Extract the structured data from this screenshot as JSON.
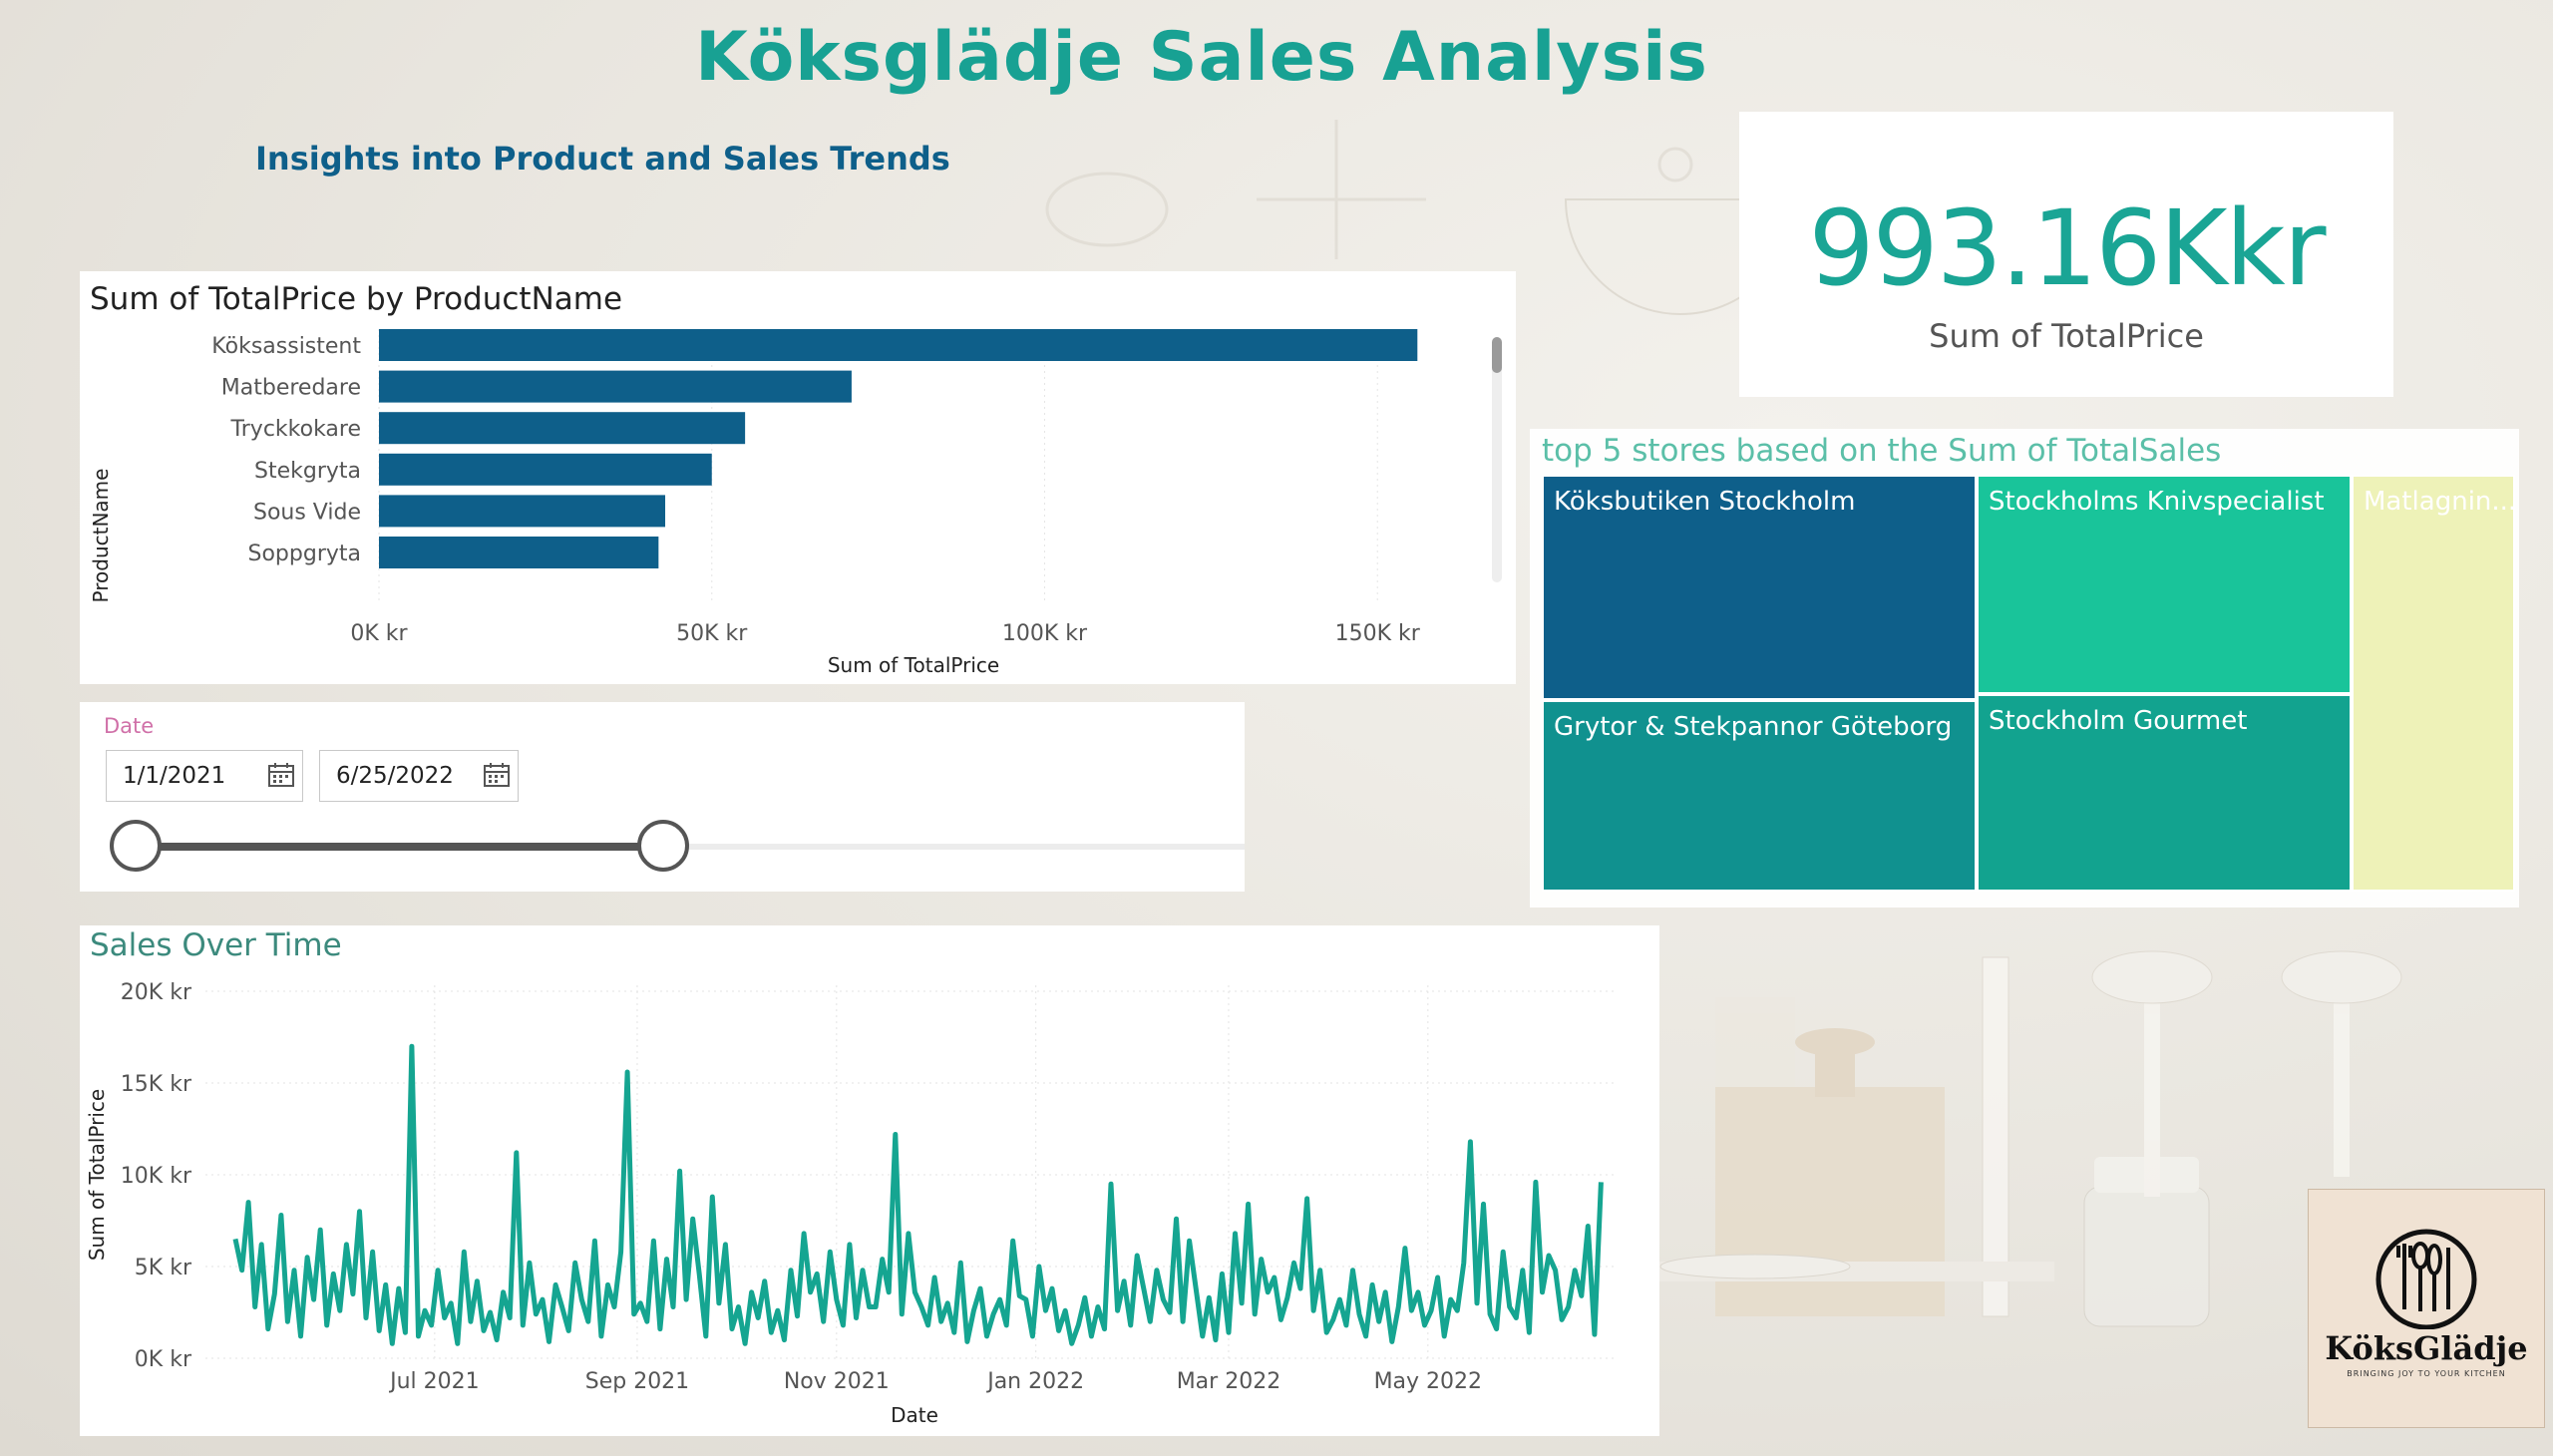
{
  "page": {
    "title": "Köksglädje Sales Analysis",
    "subtitle": "Insights into Product and Sales Trends"
  },
  "colors": {
    "title": "#18a193",
    "subtitle": "#0e5f8a",
    "bar": "#0e5f8a",
    "line": "#15a591",
    "kpi": "#1aa595"
  },
  "bar_chart": {
    "title": "Sum of TotalPrice by ProductName",
    "y_axis_title": "ProductName",
    "x_axis_title": "Sum of TotalPrice",
    "tick_labels": [
      "0K kr",
      "50K kr",
      "100K kr",
      "150K kr"
    ]
  },
  "kpi": {
    "value": "993.16Kkr",
    "label": "Sum of TotalPrice"
  },
  "treemap": {
    "title": "top 5 stores based on the Sum of TotalSales",
    "cells": [
      {
        "label": "Köksbutiken Stockholm",
        "color": "#0e5f8a"
      },
      {
        "label": "Grytor & Stekpannor Göteborg",
        "color": "#10918f"
      },
      {
        "label": "Stockholms Knivspecialist",
        "color": "#19c49a"
      },
      {
        "label": "Stockholm Gourmet",
        "color": "#12a38f"
      },
      {
        "label": "Matlagnin...",
        "color": "#eef2b8"
      }
    ]
  },
  "date_slicer": {
    "label": "Date",
    "start": "1/1/2021",
    "end": "6/25/2022",
    "start_icon": "calendar-icon",
    "end_icon": "calendar-icon"
  },
  "line_chart": {
    "title": "Sales Over Time",
    "y_axis_title": "Sum of TotalPrice",
    "x_axis_title": "Date",
    "y_tick_labels": [
      "20K kr",
      "15K kr",
      "10K kr",
      "5K kr",
      "0K kr"
    ],
    "x_tick_labels": [
      "Jul 2021",
      "Sep 2021",
      "Nov 2021",
      "Jan 2022",
      "Mar 2022",
      "May 2022"
    ]
  },
  "logo": {
    "name": "KöksGlädje",
    "tagline": "BRINGING JOY TO YOUR KITCHEN"
  },
  "chart_data": [
    {
      "type": "bar",
      "orientation": "horizontal",
      "title": "Sum of TotalPrice by ProductName",
      "xlabel": "Sum of TotalPrice",
      "ylabel": "ProductName",
      "categories": [
        "Köksassistent",
        "Matberedare",
        "Tryckkokare",
        "Stekgryta",
        "Sous Vide",
        "Soppgryta"
      ],
      "values": [
        156000,
        71000,
        55000,
        50000,
        43000,
        42000
      ],
      "xlim": [
        0,
        160000
      ],
      "xticks": [
        "0K kr",
        "50K kr",
        "100K kr",
        "150K kr"
      ],
      "grid": true
    },
    {
      "type": "line",
      "title": "Sales Over Time",
      "xlabel": "Date",
      "ylabel": "Sum of TotalPrice",
      "ylim": [
        0,
        20000
      ],
      "yticks": [
        "0K kr",
        "5K kr",
        "10K kr",
        "15K kr",
        "20K kr"
      ],
      "xticks": [
        "Jul 2021",
        "Sep 2021",
        "Nov 2021",
        "Jan 2022",
        "Mar 2022",
        "May 2022"
      ],
      "x_range": [
        "2021-05-01",
        "2022-06-25"
      ],
      "grid": true,
      "x": [
        "2021-05-01",
        "2021-05-03",
        "2021-05-05",
        "2021-05-07",
        "2021-05-09",
        "2021-05-11",
        "2021-05-13",
        "2021-05-15",
        "2021-05-17",
        "2021-05-19",
        "2021-05-21",
        "2021-05-23",
        "2021-05-25",
        "2021-05-27",
        "2021-05-29",
        "2021-05-31",
        "2021-06-02",
        "2021-06-04",
        "2021-06-06",
        "2021-06-08",
        "2021-06-10",
        "2021-06-12",
        "2021-06-14",
        "2021-06-16",
        "2021-06-18",
        "2021-06-20",
        "2021-06-22",
        "2021-06-24",
        "2021-06-26",
        "2021-06-28",
        "2021-06-30",
        "2021-07-02",
        "2021-07-04",
        "2021-07-06",
        "2021-07-08",
        "2021-07-10",
        "2021-07-12",
        "2021-07-14",
        "2021-07-16",
        "2021-07-18",
        "2021-07-20",
        "2021-07-22",
        "2021-07-24",
        "2021-07-26",
        "2021-07-28",
        "2021-07-30",
        "2021-08-01",
        "2021-08-03",
        "2021-08-05",
        "2021-08-07",
        "2021-08-09",
        "2021-08-11",
        "2021-08-13",
        "2021-08-15",
        "2021-08-17",
        "2021-08-19",
        "2021-08-21",
        "2021-08-23",
        "2021-08-25",
        "2021-08-27",
        "2021-08-29",
        "2021-08-31",
        "2021-09-02",
        "2021-09-04",
        "2021-09-06",
        "2021-09-08",
        "2021-09-10",
        "2021-09-12",
        "2021-09-14",
        "2021-09-16",
        "2021-09-18",
        "2021-09-20",
        "2021-09-22",
        "2021-09-24",
        "2021-09-26",
        "2021-09-28",
        "2021-09-30",
        "2021-10-02",
        "2021-10-04",
        "2021-10-06",
        "2021-10-08",
        "2021-10-10",
        "2021-10-12",
        "2021-10-14",
        "2021-10-16",
        "2021-10-18",
        "2021-10-20",
        "2021-10-22",
        "2021-10-24",
        "2021-10-26",
        "2021-10-28",
        "2021-10-30",
        "2021-11-01",
        "2021-11-03",
        "2021-11-05",
        "2021-11-07",
        "2021-11-09",
        "2021-11-11",
        "2021-11-13",
        "2021-11-15",
        "2021-11-17",
        "2021-11-19",
        "2021-11-21",
        "2021-11-23",
        "2021-11-25",
        "2021-11-27",
        "2021-11-29",
        "2021-12-01",
        "2021-12-03",
        "2021-12-05",
        "2021-12-07",
        "2021-12-09",
        "2021-12-11",
        "2021-12-13",
        "2021-12-15",
        "2021-12-17",
        "2021-12-19",
        "2021-12-21",
        "2021-12-23",
        "2021-12-25",
        "2021-12-27",
        "2021-12-29",
        "2021-12-31",
        "2022-01-02",
        "2022-01-04",
        "2022-01-06",
        "2022-01-08",
        "2022-01-10",
        "2022-01-12",
        "2022-01-14",
        "2022-01-16",
        "2022-01-18",
        "2022-01-20",
        "2022-01-22",
        "2022-01-24",
        "2022-01-26",
        "2022-01-28",
        "2022-01-30",
        "2022-02-01",
        "2022-02-03",
        "2022-02-05",
        "2022-02-07",
        "2022-02-09",
        "2022-02-11",
        "2022-02-13",
        "2022-02-15",
        "2022-02-17",
        "2022-02-19",
        "2022-02-21",
        "2022-02-23",
        "2022-02-25",
        "2022-02-27",
        "2022-03-01",
        "2022-03-03",
        "2022-03-05",
        "2022-03-07",
        "2022-03-09",
        "2022-03-11",
        "2022-03-13",
        "2022-03-15",
        "2022-03-17",
        "2022-03-19",
        "2022-03-21",
        "2022-03-23",
        "2022-03-25",
        "2022-03-27",
        "2022-03-29",
        "2022-03-31",
        "2022-04-02",
        "2022-04-04",
        "2022-04-06",
        "2022-04-08",
        "2022-04-10",
        "2022-04-12",
        "2022-04-14",
        "2022-04-16",
        "2022-04-18",
        "2022-04-20",
        "2022-04-22",
        "2022-04-24",
        "2022-04-26",
        "2022-04-28",
        "2022-04-30",
        "2022-05-02",
        "2022-05-04",
        "2022-05-06",
        "2022-05-08",
        "2022-05-10",
        "2022-05-12",
        "2022-05-14",
        "2022-05-16",
        "2022-05-18",
        "2022-05-20",
        "2022-05-22",
        "2022-05-24",
        "2022-05-26",
        "2022-05-28",
        "2022-05-30",
        "2022-06-01",
        "2022-06-03",
        "2022-06-05",
        "2022-06-07",
        "2022-06-09",
        "2022-06-11",
        "2022-06-13",
        "2022-06-15",
        "2022-06-17",
        "2022-06-19",
        "2022-06-21",
        "2022-06-23",
        "2022-06-25"
      ],
      "series": [
        {
          "values": [
            6500,
            4800,
            8500,
            2800,
            6200,
            1600,
            3500,
            7800,
            2000,
            4800,
            1200,
            5500,
            3200,
            7000,
            1800,
            4600,
            2600,
            6200,
            3500,
            8000,
            2200,
            5800,
            1500,
            4000,
            800,
            3800,
            1400,
            17000,
            1200,
            2600,
            1800,
            4800,
            2200,
            3000,
            800,
            5800,
            2000,
            4200,
            1500,
            2500,
            1000,
            3600,
            2200,
            11200,
            1800,
            5200,
            2400,
            3200,
            900,
            4000,
            2800,
            1500,
            5200,
            3200,
            2000,
            6400,
            1200,
            4000,
            2800,
            5800,
            15600,
            2400,
            3000,
            2000,
            6400,
            1600,
            5400,
            2800,
            10200,
            3200,
            7600,
            4600,
            1200,
            8800,
            3000,
            6200,
            1600,
            2800,
            800,
            3600,
            2200,
            4200,
            1400,
            2600,
            1000,
            4800,
            2300,
            6800,
            3600,
            4600,
            2000,
            5800,
            3200,
            1800,
            6200,
            2200,
            4800,
            2800,
            2800,
            5400,
            3600,
            12200,
            2400,
            6800,
            3600,
            2800,
            1800,
            4400,
            2000,
            3000,
            1400,
            5200,
            900,
            2600,
            3800,
            1200,
            2400,
            3200,
            1800,
            6400,
            3400,
            3200,
            1200,
            5000,
            2600,
            3800,
            1500,
            2600,
            800,
            1800,
            3300,
            1200,
            2800,
            1600,
            9500,
            2600,
            4200,
            1800,
            5600,
            3800,
            2000,
            4800,
            3200,
            2500,
            7600,
            2000,
            6400,
            3800,
            1200,
            3300,
            1000,
            4600,
            1400,
            6800,
            3000,
            8400,
            2400,
            5400,
            3600,
            4400,
            2100,
            3300,
            5200,
            3800,
            8700,
            2600,
            4800,
            1400,
            2100,
            3200,
            1800,
            4800,
            2400,
            1200,
            4000,
            2000,
            3600,
            900,
            2800,
            6000,
            2600,
            3600,
            1800,
            2600,
            4400,
            1200,
            3200,
            2600,
            5200,
            11800,
            3000,
            8400,
            2400,
            1600,
            5800,
            2800,
            2200,
            4800,
            1400,
            9600,
            3600,
            5600,
            4800,
            2100,
            2800,
            4800,
            3400,
            7200,
            1300,
            9600
          ]
        }
      ]
    },
    {
      "type": "treemap",
      "title": "top 5 stores based on the Sum of TotalSales",
      "categories": [
        "Köksbutiken Stockholm",
        "Grytor & Stekpannor Göteborg",
        "Stockholms Knivspecialist",
        "Stockholm Gourmet",
        "Matlagnin..."
      ]
    }
  ]
}
